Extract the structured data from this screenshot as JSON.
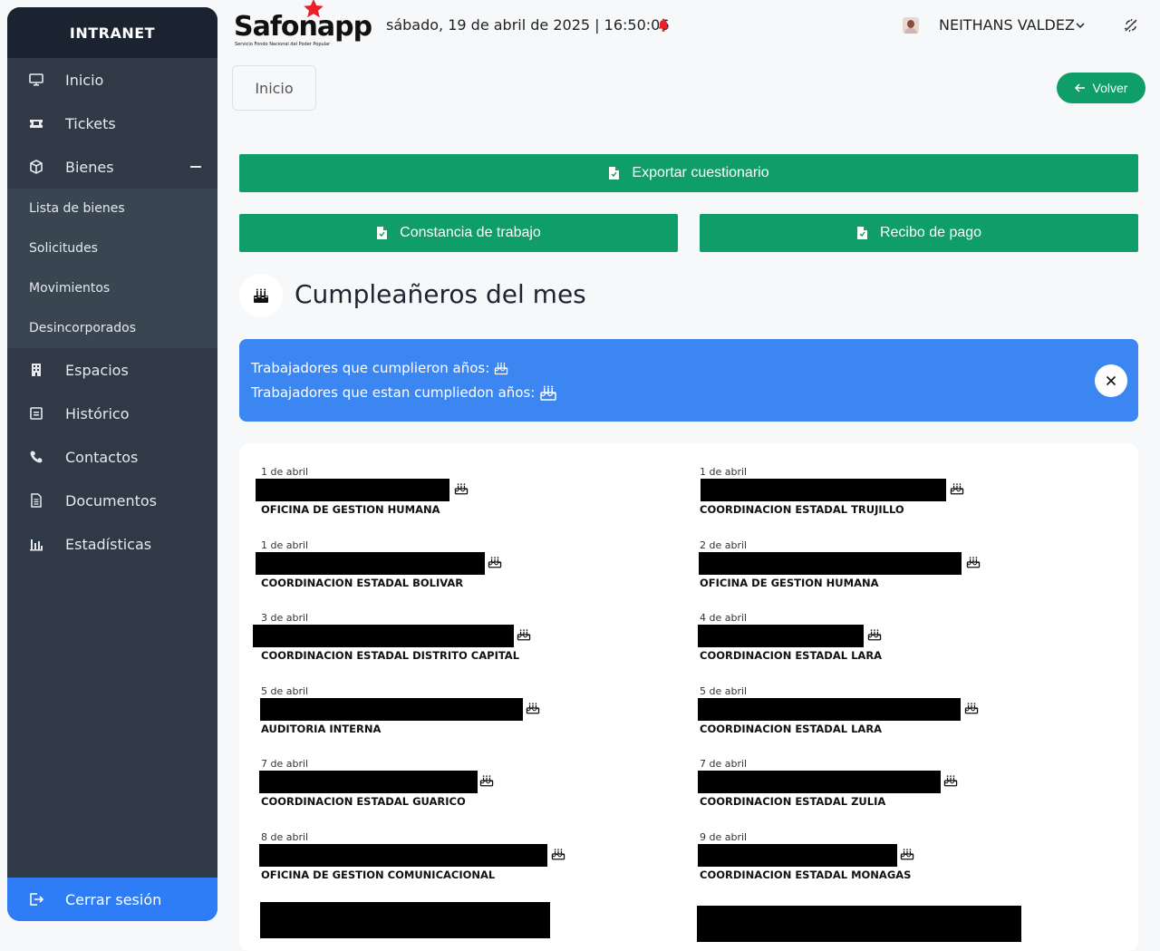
{
  "sidebar": {
    "title": "INTRANET",
    "items": [
      {
        "label": "Inicio",
        "icon": "monitor-icon"
      },
      {
        "label": "Tickets",
        "icon": "ticket-icon"
      },
      {
        "label": "Bienes",
        "icon": "box-icon"
      },
      {
        "label": "Espacios",
        "icon": "building-icon"
      },
      {
        "label": "Histórico",
        "icon": "archive-icon"
      },
      {
        "label": "Contactos",
        "icon": "phone-icon"
      },
      {
        "label": "Documentos",
        "icon": "document-icon"
      },
      {
        "label": "Estadísticas",
        "icon": "bar-chart-icon"
      }
    ],
    "submenu": [
      "Lista de bienes",
      "Solicitudes",
      "Movimientos",
      "Desincorporados"
    ],
    "logout": "Cerrar sesión"
  },
  "header": {
    "logo_text": "Safonapp",
    "logo_subtitle": "Servicio Fondo Nacional del Poder Popular",
    "datetime": "sábado, 19 de abril de 2025 | 16:50:06",
    "username": "NEITHANS VALDEZ"
  },
  "breadcrumb": "Inicio",
  "back_button": "Volver",
  "actions": {
    "export": "Exportar cuestionario",
    "constancia": "Constancia de trabajo",
    "recibo": "Recibo de pago"
  },
  "birthday": {
    "title": "Cumpleañeros del mes",
    "alert_line1": "Trabajadores que cumplieron años:",
    "alert_line2": "Trabajadores que estan cumpliedon años:",
    "entries": [
      {
        "date": "1 de abril",
        "dept": "OFICINA DE GESTION HUMANA"
      },
      {
        "date": "1 de abril",
        "dept": "COORDINACION ESTADAL TRUJILLO"
      },
      {
        "date": "1 de abril",
        "dept": "COORDINACION ESTADAL BOLIVAR"
      },
      {
        "date": "2 de abril",
        "dept": "OFICINA DE GESTION HUMANA"
      },
      {
        "date": "3 de abril",
        "dept": "COORDINACION ESTADAL DISTRITO CAPITAL"
      },
      {
        "date": "4 de abril",
        "dept": "COORDINACION ESTADAL LARA"
      },
      {
        "date": "5 de abril",
        "dept": "AUDITORIA INTERNA"
      },
      {
        "date": "5 de abril",
        "dept": "COORDINACION ESTADAL LARA"
      },
      {
        "date": "7 de abril",
        "dept": "COORDINACION ESTADAL GUARICO"
      },
      {
        "date": "7 de abril",
        "dept": "COORDINACION ESTADAL ZULIA"
      },
      {
        "date": "8 de abril",
        "dept": "OFICINA DE GESTION COMUNICACIONAL"
      },
      {
        "date": "9 de abril",
        "dept": "COORDINACION ESTADAL MONAGAS"
      }
    ]
  },
  "colors": {
    "sidebar_bg": "#2f3a46",
    "sidebar_header": "#1b2230",
    "accent_green": "#0f9d6a",
    "alert_blue": "#3b86f0",
    "logout_blue": "#2e7df6",
    "logo_star": "#e8202a"
  }
}
